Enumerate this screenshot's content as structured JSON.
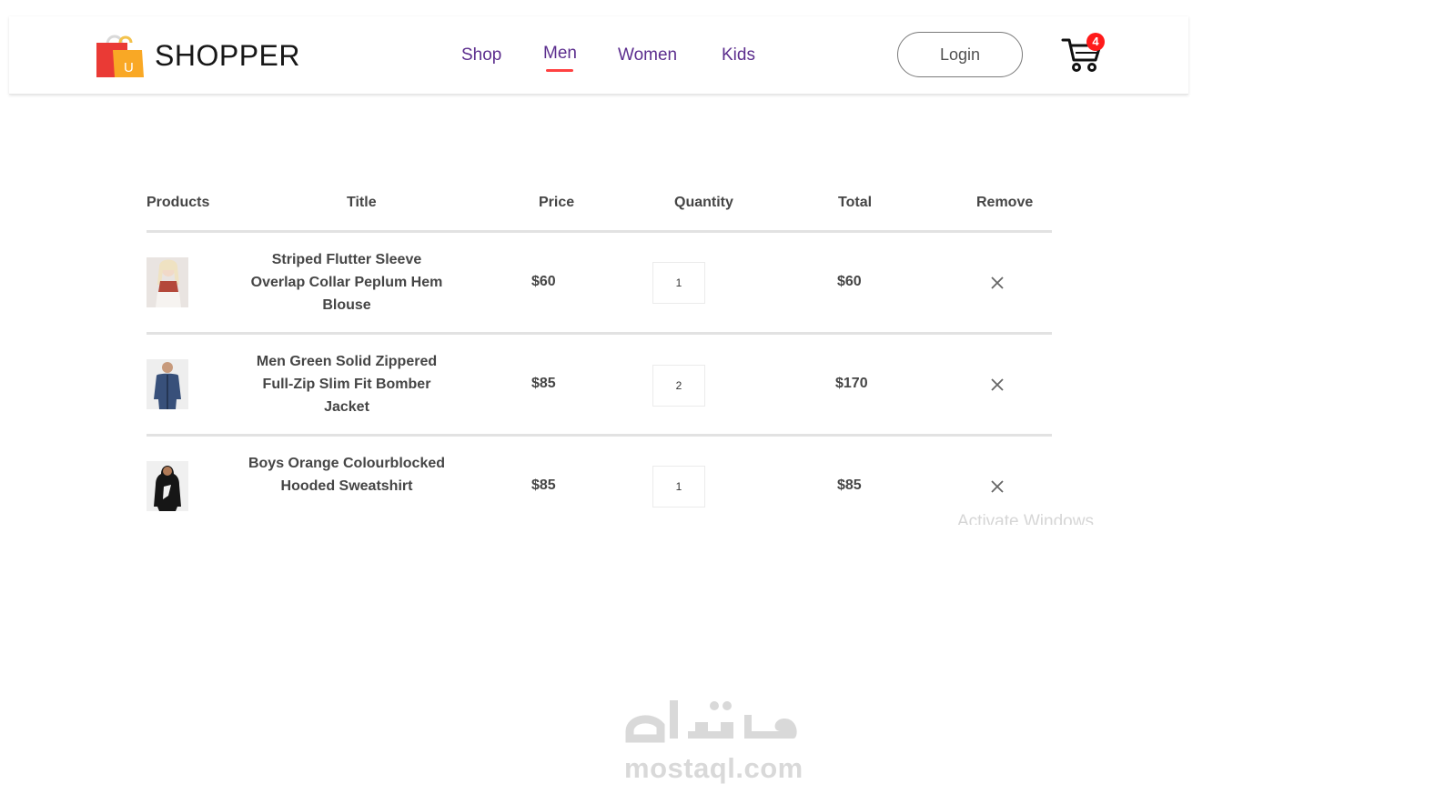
{
  "brand": {
    "name": "SHOPPER",
    "logo_letter": "U"
  },
  "nav": {
    "items": [
      {
        "label": "Shop"
      },
      {
        "label": "Men"
      },
      {
        "label": "Women"
      },
      {
        "label": "Kids"
      }
    ],
    "active": "Men"
  },
  "header_actions": {
    "login_label": "Login",
    "cart_count": "4"
  },
  "cart_table": {
    "headers": {
      "products": "Products",
      "title": "Title",
      "price": "Price",
      "quantity": "Quantity",
      "total": "Total",
      "remove": "Remove"
    },
    "rows": [
      {
        "title": "Striped Flutter Sleeve Overlap Collar Peplum Hem Blouse",
        "price": "$60",
        "quantity": "1",
        "total": "$60"
      },
      {
        "title": "Men Green Solid Zippered Full-Zip Slim Fit Bomber Jacket",
        "price": "$85",
        "quantity": "2",
        "total": "$170"
      },
      {
        "title": "Boys Orange Colourblocked Hooded Sweatshirt",
        "price": "$85",
        "quantity": "1",
        "total": "$85"
      }
    ]
  },
  "overlays": {
    "activate_windows": "Activate Windows",
    "watermark_url": "mostaql.com"
  },
  "colors": {
    "accent": "#ff4141",
    "nav_text": "#5c2e8e",
    "badge": "#ff1a1a"
  }
}
